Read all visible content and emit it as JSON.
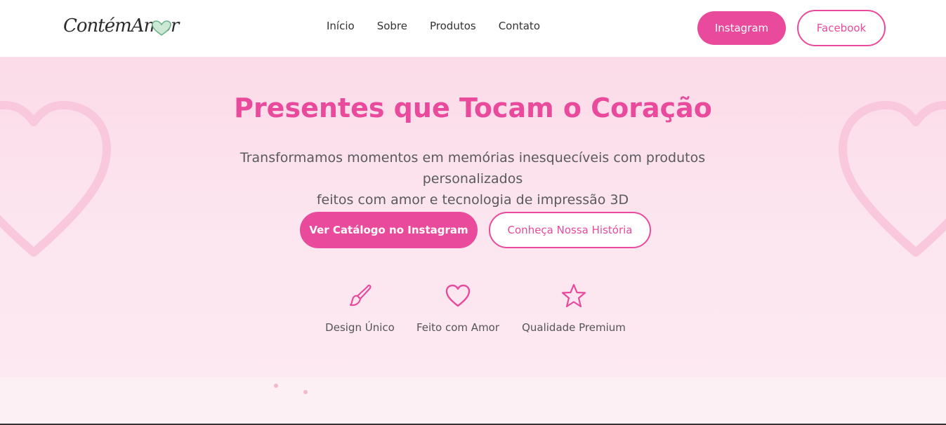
{
  "brand": {
    "logo_text": "ContémAmor",
    "logo_heart_color": "#7cc59a"
  },
  "nav": {
    "items": [
      "Início",
      "Sobre",
      "Produtos",
      "Contato"
    ]
  },
  "header_actions": {
    "instagram_label": "Instagram",
    "facebook_label": "Facebook"
  },
  "hero": {
    "title": "Presentes que Tocam o Coração",
    "subtitle_line1": "Transformamos momentos em memórias inesquecíveis com produtos personalizados",
    "subtitle_line2": "feitos com amor e tecnologia de impressão 3D",
    "primary_button": "Ver Catálogo no Instagram",
    "secondary_button": "Conheça Nossa História"
  },
  "features": [
    {
      "icon": "paintbrush-icon",
      "label": "Design Único"
    },
    {
      "icon": "heart-icon",
      "label": "Feito com Amor"
    },
    {
      "icon": "star-icon",
      "label": "Qualidade Premium"
    }
  ],
  "colors": {
    "accent": "#e94a9c",
    "hero_bg": "#fbdbe8",
    "text": "#555555"
  }
}
